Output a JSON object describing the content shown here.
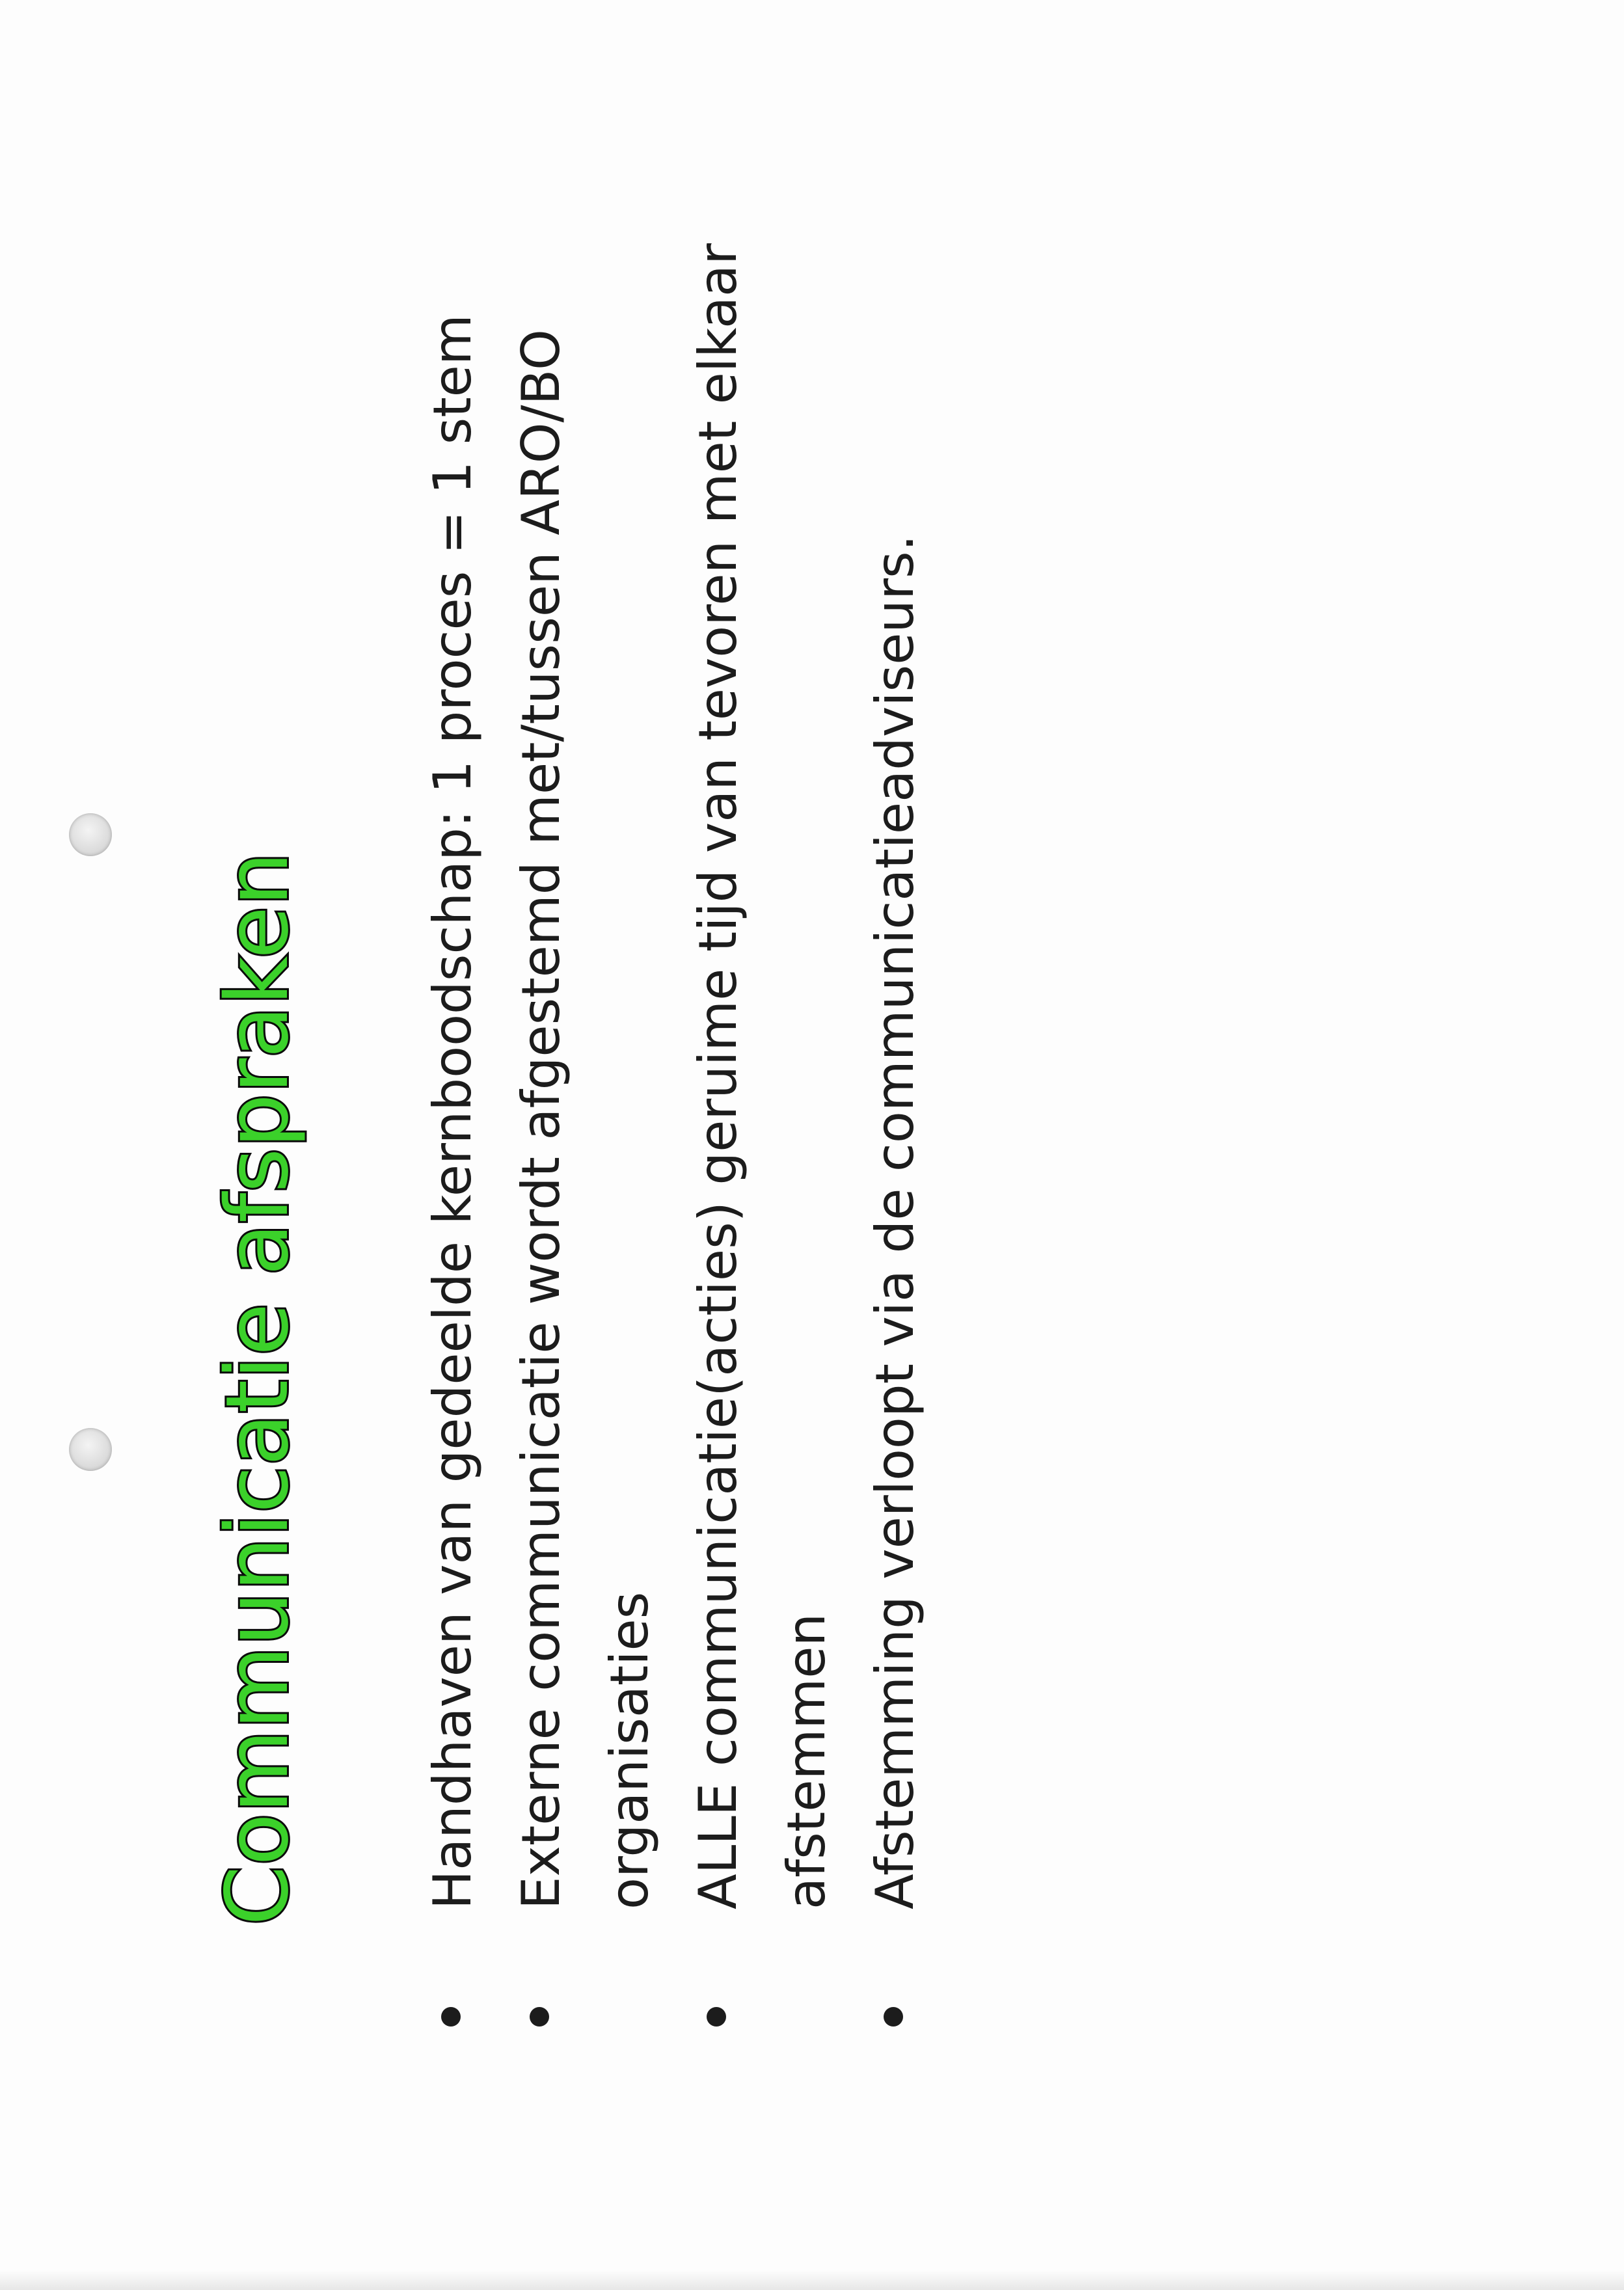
{
  "slide": {
    "title": "Communicatie afspraken",
    "bullets": [
      {
        "text": "Handhaven van gedeelde kernboodschap: 1 proces = 1 stem"
      },
      {
        "text": "Externe communicatie wordt afgestemd met/tussen ARO/BO organisaties"
      },
      {
        "text": "ALLE communicatie(acties) geruime tijd van tevoren met elkaar afstemmen"
      },
      {
        "text": "Afstemming verloopt via de communicatieadviseurs."
      }
    ]
  },
  "colors": {
    "title_fill": "#3bd12a",
    "title_outline": "#0b0b0b",
    "body_text": "#1c1c1c",
    "paper": "#fdfdfd"
  }
}
